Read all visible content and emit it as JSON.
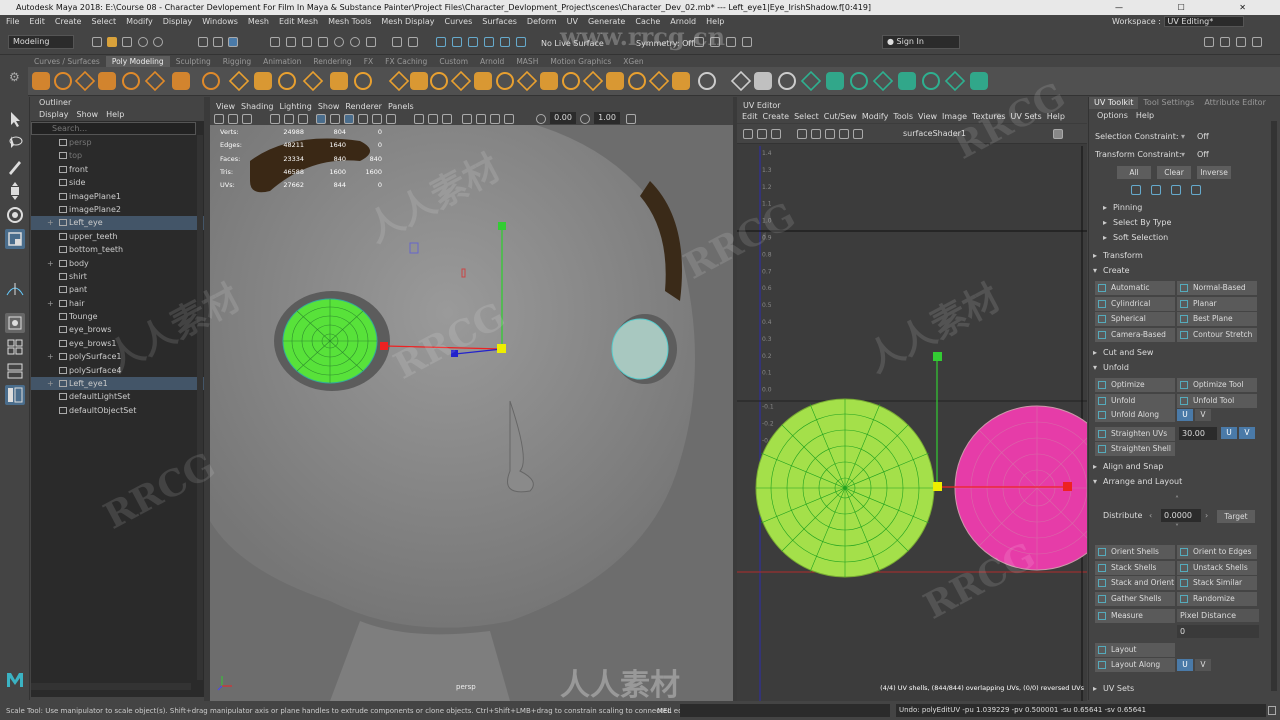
{
  "window": {
    "title": "Autodesk Maya 2018: E:\\Course 08 - Character Devlopement For Film In Maya & Substance Painter\\Project Files\\Character_Devlopment_Project\\scenes\\Character_Dev_02.mb*   ---   Left_eye1|Eye_IrishShadow.f[0:419]",
    "controls": "— ☐ ✕"
  },
  "menubar": [
    "File",
    "Edit",
    "Create",
    "Select",
    "Modify",
    "Display",
    "Windows",
    "Mesh",
    "Edit Mesh",
    "Mesh Tools",
    "Mesh Display",
    "Curves",
    "Surfaces",
    "Deform",
    "UV",
    "Generate",
    "Cache",
    "Arnold",
    "Help"
  ],
  "workspace": {
    "label": "Workspace :",
    "value": "UV Editing*"
  },
  "statusline": {
    "mode": "Modeling",
    "live_surface": "No Live Surface",
    "symmetry": "Symmetry: Off",
    "signin": "Sign In"
  },
  "shelf_tabs": [
    "Curves / Surfaces",
    "Poly Modeling",
    "Sculpting",
    "Rigging",
    "Animation",
    "Rendering",
    "FX",
    "FX Caching",
    "Custom",
    "Arnold",
    "MASH",
    "Motion Graphics",
    "XGen"
  ],
  "shelf_active": "Poly Modeling",
  "outliner": {
    "title": "Outliner",
    "menu": [
      "Display",
      "Show",
      "Help"
    ],
    "search_placeholder": "Search...",
    "items": [
      {
        "label": "persp",
        "plus": "",
        "selected": false,
        "dim": true
      },
      {
        "label": "top",
        "plus": "",
        "selected": false,
        "dim": true
      },
      {
        "label": "front",
        "plus": "",
        "selected": false,
        "dim": false
      },
      {
        "label": "side",
        "plus": "",
        "selected": false,
        "dim": false
      },
      {
        "label": "imagePlane1",
        "plus": "",
        "selected": false,
        "dim": false
      },
      {
        "label": "imagePlane2",
        "plus": "",
        "selected": false,
        "dim": false
      },
      {
        "label": "Left_eye",
        "plus": "+",
        "selected": true,
        "dim": false
      },
      {
        "label": "upper_teeth",
        "plus": "",
        "selected": false,
        "dim": false
      },
      {
        "label": "bottom_teeth",
        "plus": "",
        "selected": false,
        "dim": false
      },
      {
        "label": "body",
        "plus": "+",
        "selected": false,
        "dim": false
      },
      {
        "label": "shirt",
        "plus": "",
        "selected": false,
        "dim": false
      },
      {
        "label": "pant",
        "plus": "",
        "selected": false,
        "dim": false
      },
      {
        "label": "hair",
        "plus": "+",
        "selected": false,
        "dim": false
      },
      {
        "label": "Tounge",
        "plus": "",
        "selected": false,
        "dim": false
      },
      {
        "label": "eye_brows",
        "plus": "",
        "selected": false,
        "dim": false
      },
      {
        "label": "eye_brows1",
        "plus": "",
        "selected": false,
        "dim": false
      },
      {
        "label": "polySurface1",
        "plus": "+",
        "selected": false,
        "dim": false
      },
      {
        "label": "polySurface4",
        "plus": "",
        "selected": false,
        "dim": false
      },
      {
        "label": "Left_eye1",
        "plus": "+",
        "selected": true,
        "dim": false
      },
      {
        "label": "defaultLightSet",
        "plus": "",
        "selected": false,
        "dim": false
      },
      {
        "label": "defaultObjectSet",
        "plus": "",
        "selected": false,
        "dim": false
      }
    ]
  },
  "viewport": {
    "menu": [
      "View",
      "Shading",
      "Lighting",
      "Show",
      "Renderer",
      "Panels"
    ],
    "exposure": "0.00",
    "gamma": "1.00",
    "camera": "persp",
    "hud": [
      {
        "label": "Verts:",
        "a": "24988",
        "b": "804",
        "c": "0"
      },
      {
        "label": "Edges:",
        "a": "48211",
        "b": "1640",
        "c": "0"
      },
      {
        "label": "Faces:",
        "a": "23334",
        "b": "840",
        "c": "840"
      },
      {
        "label": "Tris:",
        "a": "46588",
        "b": "1600",
        "c": "1600"
      },
      {
        "label": "UVs:",
        "a": "27662",
        "b": "844",
        "c": "0"
      }
    ]
  },
  "uv_editor": {
    "title": "UV Editor",
    "menu": [
      "Edit",
      "Create",
      "Select",
      "Cut/Sew",
      "Modify",
      "Tools",
      "View",
      "Image",
      "Textures",
      "UV Sets",
      "Help"
    ],
    "shader": "surfaceShader1",
    "status": "(4/4) UV shells, (844/844) overlapping UVs, (0/0) reversed UVs",
    "ruler": [
      "1.4",
      "1.3",
      "1.2",
      "1.1",
      "1.0",
      "0.9",
      "0.8",
      "0.7",
      "0.6",
      "0.5",
      "0.4",
      "0.3",
      "0.2",
      "0.1",
      "0.0",
      "-0.1",
      "-0.2",
      "-0.3",
      "-0.4",
      "-0.5",
      "-0.6",
      "-0.7"
    ]
  },
  "toolkit": {
    "tabs": [
      "UV Toolkit",
      "Tool Settings",
      "Attribute Editor"
    ],
    "menu": [
      "Options",
      "Help"
    ],
    "selection_constraint": {
      "label": "Selection Constraint:",
      "value": "Off"
    },
    "transform_constraint": {
      "label": "Transform Constraint:",
      "value": "Off"
    },
    "sel_buttons": [
      "All",
      "Clear",
      "Inverse"
    ],
    "subsections": [
      "Pinning",
      "Select By Type",
      "Soft Selection"
    ],
    "transform": "Transform",
    "create": "Create",
    "create_buttons": [
      "Automatic",
      "Normal-Based",
      "Cylindrical",
      "Planar",
      "Spherical",
      "Best Plane",
      "Camera-Based",
      "Contour Stretch"
    ],
    "cut_sew": "Cut and Sew",
    "unfold": "Unfold",
    "unfold_buttons": [
      "Optimize",
      "Optimize Tool",
      "Unfold",
      "Unfold Tool"
    ],
    "unfold_along": "Unfold Along",
    "straighten_uvs": "Straighten UVs",
    "straighten_value": "30.00",
    "straighten_shell": "Straighten Shell",
    "u": "U",
    "v": "V",
    "align_snap": "Align and Snap",
    "arrange_layout": "Arrange and Layout",
    "distribute": "Distribute",
    "distribute_value": "0.0000",
    "target": "Target",
    "arrange_buttons": [
      "Orient Shells",
      "Orient to Edges",
      "Stack Shells",
      "Unstack Shells",
      "Stack and Orient",
      "Stack Similar",
      "Gather Shells",
      "Randomize Shells"
    ],
    "measure": "Measure",
    "measure_unit": "Pixel Distance",
    "measure_value": "0",
    "layout": "Layout",
    "layout_along": "Layout Along",
    "uv_sets": "UV Sets"
  },
  "bottom": {
    "help": "Scale Tool: Use manipulator to scale object(s). Shift+drag manipulator axis or plane handles to extrude components or clone objects. Ctrl+Shift+LMB+drag to constrain scaling to connected edges. Use D or INSERT",
    "mel": "MEL",
    "result": "Undo: polyEditUV -pu 1.039229 -pv 0.500001 -su 0.65641 -sv 0.65641"
  },
  "watermarks": [
    "www.rrcg.cn",
    "RRCG",
    "人人素材"
  ]
}
